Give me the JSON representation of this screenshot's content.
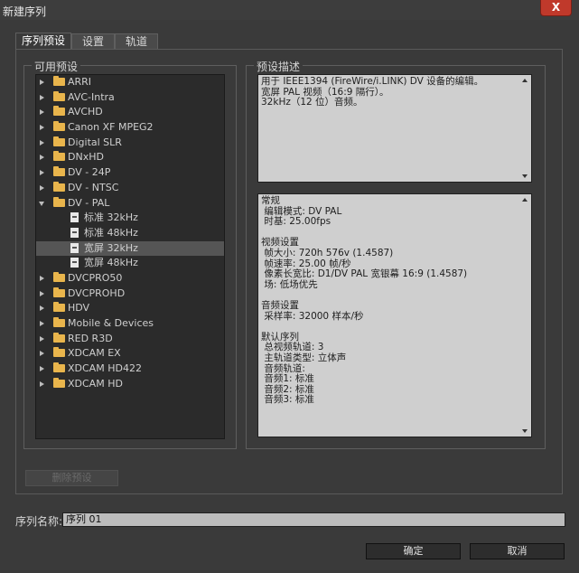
{
  "window": {
    "title": "新建序列",
    "close_label": "X"
  },
  "tabs": [
    "序列预设",
    "设置",
    "轨道"
  ],
  "left_group": {
    "label": "可用预设",
    "tree": [
      {
        "label": "ARRI",
        "type": "folder",
        "expanded": false
      },
      {
        "label": "AVC-Intra",
        "type": "folder",
        "expanded": false
      },
      {
        "label": "AVCHD",
        "type": "folder",
        "expanded": false
      },
      {
        "label": "Canon XF MPEG2",
        "type": "folder",
        "expanded": false
      },
      {
        "label": "Digital SLR",
        "type": "folder",
        "expanded": false
      },
      {
        "label": "DNxHD",
        "type": "folder",
        "expanded": false
      },
      {
        "label": "DV - 24P",
        "type": "folder",
        "expanded": false
      },
      {
        "label": "DV - NTSC",
        "type": "folder",
        "expanded": false
      },
      {
        "label": "DV - PAL",
        "type": "folder",
        "expanded": true
      },
      {
        "label": "标准 32kHz",
        "type": "preset"
      },
      {
        "label": "标准 48kHz",
        "type": "preset"
      },
      {
        "label": "宽屏 32kHz",
        "type": "preset",
        "selected": true
      },
      {
        "label": "宽屏 48kHz",
        "type": "preset"
      },
      {
        "label": "DVCPRO50",
        "type": "folder",
        "expanded": false
      },
      {
        "label": "DVCPROHD",
        "type": "folder",
        "expanded": false
      },
      {
        "label": "HDV",
        "type": "folder",
        "expanded": false
      },
      {
        "label": "Mobile & Devices",
        "type": "folder",
        "expanded": false
      },
      {
        "label": "RED R3D",
        "type": "folder",
        "expanded": false
      },
      {
        "label": "XDCAM EX",
        "type": "folder",
        "expanded": false
      },
      {
        "label": "XDCAM HD422",
        "type": "folder",
        "expanded": false
      },
      {
        "label": "XDCAM HD",
        "type": "folder",
        "expanded": false
      }
    ],
    "delete_button": "删除预设"
  },
  "right_group": {
    "label": "预设描述",
    "description_lines": [
      "用于 IEEE1394 (FireWire/i.LINK) DV 设备的编辑。",
      "宽屏 PAL 视频（16:9 隔行）。",
      "32kHz（12 位）音频。"
    ],
    "detail_lines": [
      "常规",
      " 编辑模式: DV PAL",
      " 时基: 25.00fps",
      "",
      "视频设置",
      " 帧大小: 720h 576v (1.4587)",
      " 帧速率: 25.00 帧/秒",
      " 像素长宽比: D1/DV PAL 宽银幕 16:9 (1.4587)",
      " 场: 低场优先",
      "",
      "音频设置",
      " 采样率: 32000 样本/秒",
      "",
      "默认序列",
      " 总视频轨道: 3",
      " 主轨道类型: 立体声",
      " 音频轨道:",
      " 音频1: 标准",
      " 音频2: 标准",
      " 音频3: 标准"
    ]
  },
  "sequence_name": {
    "label": "序列名称:",
    "value": "序列 01"
  },
  "buttons": {
    "ok": "确定",
    "cancel": "取消"
  }
}
